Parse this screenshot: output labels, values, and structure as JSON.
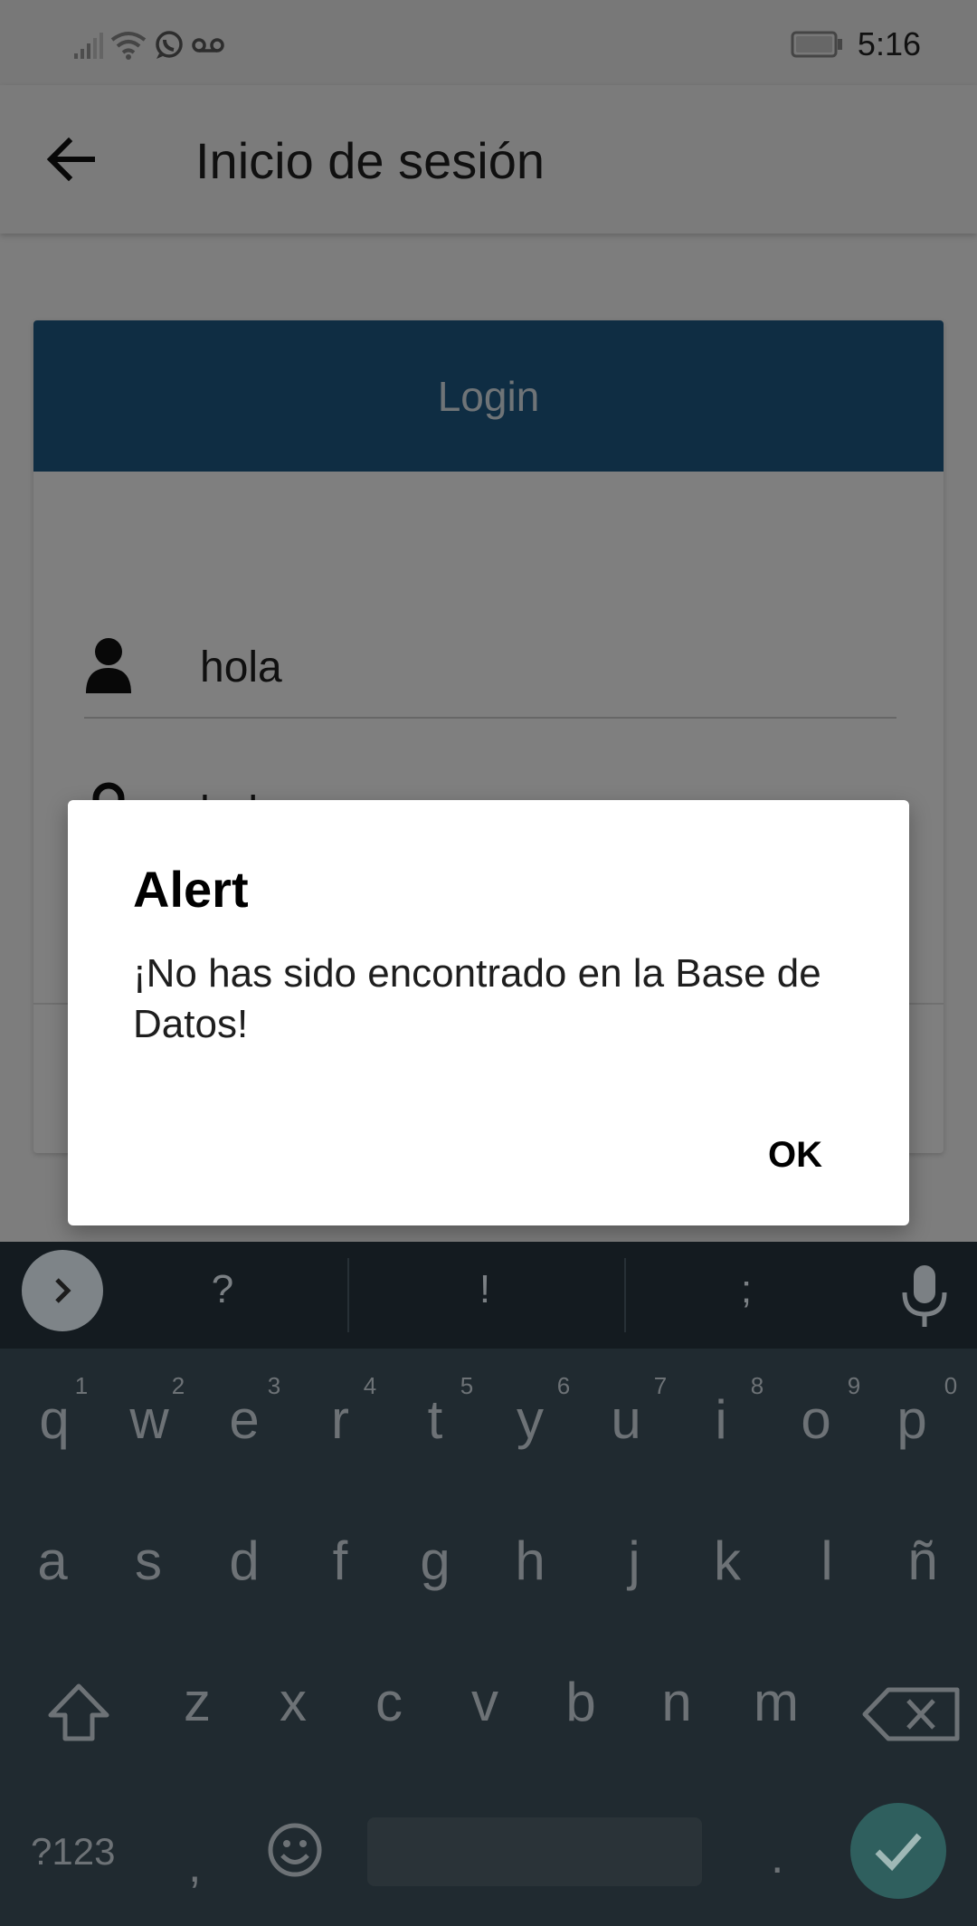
{
  "status_bar": {
    "time": "5:16",
    "icons": [
      "signal-icon",
      "wifi-icon",
      "whatsapp-icon",
      "voicemail-icon",
      "battery-icon"
    ]
  },
  "app_bar": {
    "title": "Inicio de sesión",
    "back_icon": "arrow-back-icon"
  },
  "login_card": {
    "header_label": "Login",
    "username": {
      "icon": "person-icon",
      "value": "hola"
    },
    "password": {
      "icon": "lock-icon",
      "value": "hola"
    }
  },
  "dialog": {
    "title": "Alert",
    "message": "¡No has sido encontrado en la Base de Datos!",
    "ok_label": "OK"
  },
  "keyboard": {
    "suggestions": [
      "?",
      "!",
      ";"
    ],
    "row1": [
      "q",
      "w",
      "e",
      "r",
      "t",
      "y",
      "u",
      "i",
      "o",
      "p"
    ],
    "row1_hints": [
      "1",
      "2",
      "3",
      "4",
      "5",
      "6",
      "7",
      "8",
      "9",
      "0"
    ],
    "row2": [
      "a",
      "s",
      "d",
      "f",
      "g",
      "h",
      "j",
      "k",
      "l",
      "ñ"
    ],
    "row3": [
      "z",
      "x",
      "c",
      "v",
      "b",
      "n",
      "m"
    ],
    "symbols_label": "?123",
    "comma": ",",
    "period": "."
  },
  "colors": {
    "header": "#1f5a86",
    "scrim": "rgba(0,0,0,0.5)",
    "keyboard_bg": "#202a30",
    "enter": "#2f5f5e"
  }
}
